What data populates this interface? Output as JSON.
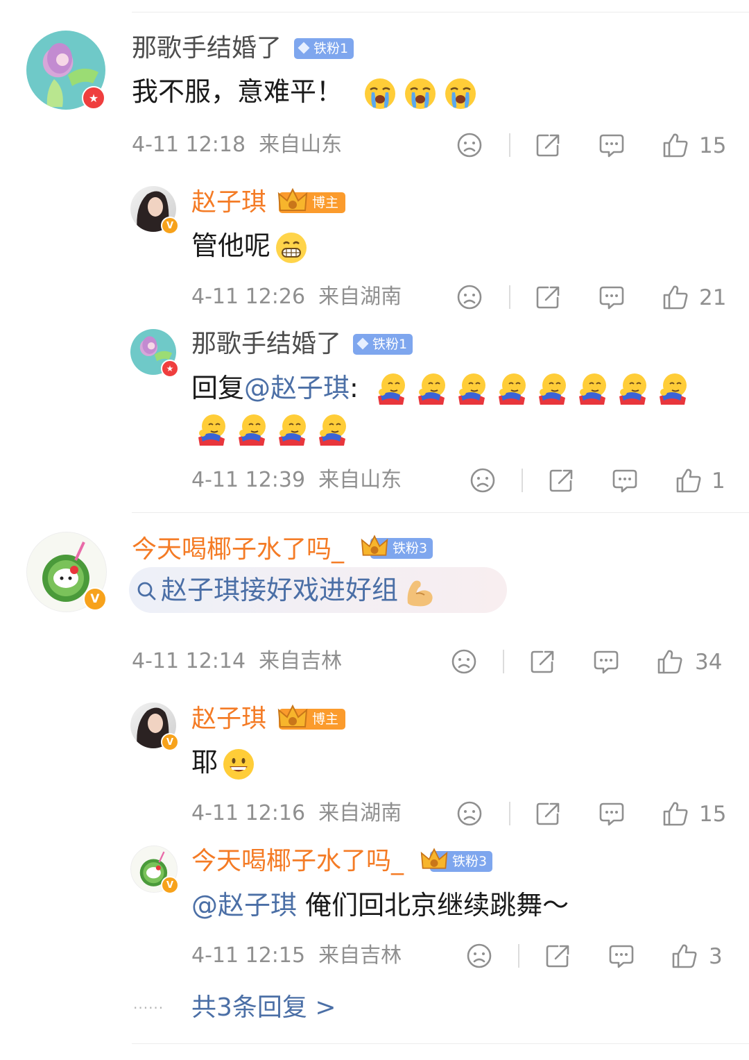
{
  "comments": [
    {
      "user": "那歌手结婚了",
      "fan_badge": "铁粉1",
      "text": "我不服，意难平！",
      "time": "4-11 12:18",
      "location": "来自山东",
      "likes": "15",
      "replies": [
        {
          "user": "赵子琪",
          "blogger_badge": "博主",
          "text": "管他呢",
          "time": "4-11 12:26",
          "location": "来自湖南",
          "likes": "21"
        },
        {
          "user": "那歌手结婚了",
          "fan_badge": "铁粉1",
          "reply_prefix": "回复",
          "mention": "@赵子琪",
          "colon": ":",
          "time": "4-11 12:39",
          "location": "来自山东",
          "likes": "1"
        }
      ]
    },
    {
      "user": "今天喝椰子水了吗_",
      "fan_badge": "铁粉3",
      "search_topic": "赵子琪接好戏进好组",
      "time": "4-11 12:14",
      "location": "来自吉林",
      "likes": "34",
      "replies": [
        {
          "user": "赵子琪",
          "blogger_badge": "博主",
          "text": "耶",
          "time": "4-11 12:16",
          "location": "来自湖南",
          "likes": "15"
        },
        {
          "user": "今天喝椰子水了吗_",
          "fan_badge": "铁粉3",
          "mention": "@赵子琪",
          "text": "俺们回北京继续跳舞～",
          "time": "4-11 12:15",
          "location": "来自吉林",
          "likes": "3"
        }
      ],
      "more_replies": "共3条回复 >",
      "dots": "······"
    }
  ],
  "colors": {
    "orange_name": "#f47b25",
    "link_blue": "#4b6fa6",
    "fan_badge_blue": "#7ea6ee",
    "blogger_badge_orange": "#fb9b2c",
    "meta_gray": "#8f8f8f"
  },
  "icons": [
    "dislike-face-icon",
    "share-icon",
    "comment-icon",
    "thumbs-up-icon",
    "search-icon"
  ]
}
